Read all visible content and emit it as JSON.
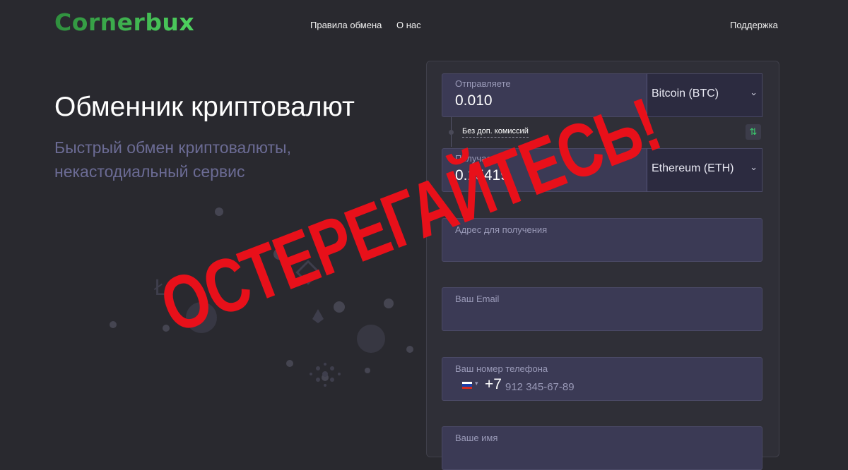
{
  "header": {
    "logo": "Cornerbux",
    "nav": [
      {
        "label": "Правила обмена"
      },
      {
        "label": "О нас"
      }
    ],
    "support": "Поддержка"
  },
  "hero": {
    "title": "Обменник криптовалют",
    "subtitle_line1": "Быстрый обмен криптовалюты,",
    "subtitle_line2": "некастодиальный сервис"
  },
  "exchange": {
    "send": {
      "label": "Отправляете",
      "value": "0.010",
      "coin": "Bitcoin (BTC)"
    },
    "fee_note": "Без доп. комиссий",
    "receive": {
      "label": "Получаете",
      "value": "0.15419",
      "coin": "Ethereum (ETH)"
    },
    "address": {
      "label": "Адрес для получения"
    },
    "email": {
      "label": "Ваш Email"
    },
    "phone": {
      "label": "Ваш номер телефона",
      "code": "+7",
      "placeholder": "912 345-67-89"
    },
    "name": {
      "label": "Ваше имя"
    }
  },
  "watermark": "ОСТЕРЕГАЙТЕСЬ!",
  "colors": {
    "background": "#29292f",
    "brand": "#3fb54f",
    "stamp": "#e8101a",
    "field": "#3b3a55"
  }
}
